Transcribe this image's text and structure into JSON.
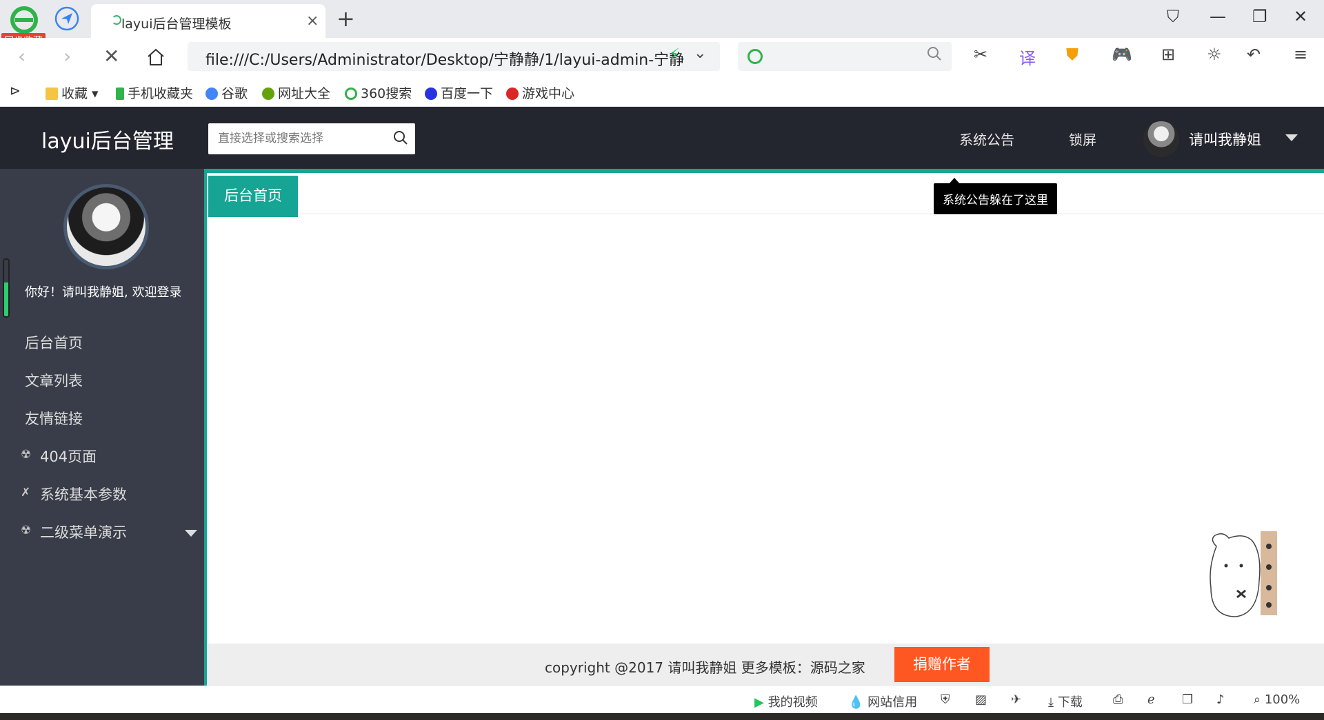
{
  "browser": {
    "sync_badge": "同步收藏",
    "tab_title": "layui后台管理模板",
    "tab_close": "×",
    "new_tab": "+",
    "url": "file:///C:/Users/Administrator/Desktop/宁静静/1/layui-admin-宁静",
    "search_placeholder": "",
    "zoom": "100%",
    "bookmarks": [
      "收藏",
      "手机收藏夹",
      "谷歌",
      "网址大全",
      "360搜索",
      "百度一下",
      "游戏中心"
    ],
    "status_items": [
      "我的视频",
      "网站信用",
      "下载"
    ]
  },
  "app": {
    "logo": "layui后台管理",
    "search_placeholder": "直接选择或搜索选择",
    "nav_notice": "系统公告",
    "nav_lock": "锁屏",
    "user_name": "请叫我静姐",
    "welcome": "你好！请叫我静姐, 欢迎登录",
    "menu": [
      {
        "label": "后台首页"
      },
      {
        "label": "文章列表"
      },
      {
        "label": "友情链接"
      },
      {
        "label": "404页面"
      },
      {
        "label": "系统基本参数"
      },
      {
        "label": "二级菜单演示"
      }
    ],
    "active_tab": "后台首页",
    "tooltip": "系统公告躲在了这里",
    "copyright": "copyright @2017 请叫我静姐 更多模板：源码之家",
    "donate": "捐赠作者"
  },
  "colors": {
    "header_bg": "#23262e",
    "sidebar_bg": "#393d49",
    "accent_teal": "#16a594",
    "donate_orange": "#ff5722"
  }
}
